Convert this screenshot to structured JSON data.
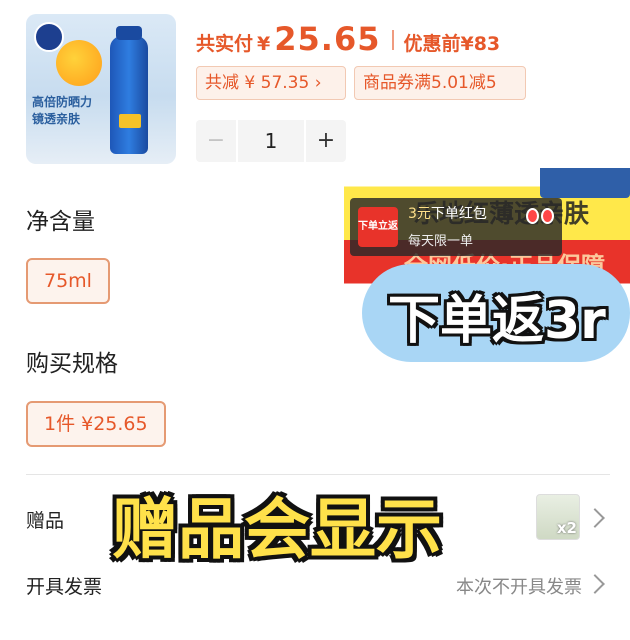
{
  "product": {
    "image_tagline": "高倍防晒力 镜透亲肤",
    "pay_label": "共实付",
    "currency": "¥",
    "pay_amount": "25.65",
    "original_label": "优惠前",
    "original_price": "¥83",
    "discount_tag": "共减 ¥ 57.35 ›",
    "coupon_tag": "商品券满5.01减5"
  },
  "quantity": {
    "minus": "−",
    "value": "1",
    "plus": "+"
  },
  "spec": {
    "title": "净含量",
    "option": "75ml"
  },
  "purchase": {
    "title": "购买规格",
    "option": "1件 ¥25.65"
  },
  "promo_banner": {
    "bg_text_top": "乐地红薄透亲肤",
    "bg_text_bottom": "全网低价·正品保障",
    "coupon_icon": "下单立返",
    "coupon_title_highlight": "3元",
    "coupon_title_rest": "下单红包",
    "coupon_sub": "每天限一单"
  },
  "cashback_sticker": "下单返3r",
  "gift": {
    "label": "赠品",
    "count": "x2"
  },
  "gift_overlay": "赠品会显示",
  "invoice": {
    "label": "开具发票",
    "value": "本次不开具发票"
  },
  "colors": {
    "accent": "#e6582a",
    "tag_bg": "#fdf1ea",
    "overlay_yellow": "#ffe14a",
    "bubble_blue": "#a9d6f5"
  }
}
